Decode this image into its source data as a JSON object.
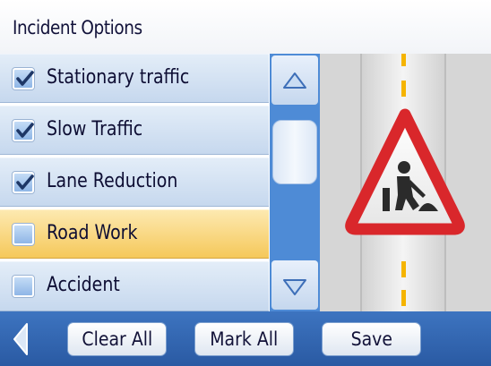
{
  "header": {
    "title": "Incident Options"
  },
  "options": [
    {
      "label": "Stationary traffic",
      "checked": true,
      "selected": false
    },
    {
      "label": "Slow Traffic",
      "checked": true,
      "selected": false
    },
    {
      "label": "Lane Reduction",
      "checked": true,
      "selected": false
    },
    {
      "label": "Road Work",
      "checked": false,
      "selected": true
    },
    {
      "label": "Accident",
      "checked": false,
      "selected": false
    }
  ],
  "preview": {
    "icon": "road-work-warning-sign"
  },
  "footer": {
    "back_icon": "back-arrow-icon",
    "clear_all": "Clear All",
    "mark_all": "Mark All",
    "save": "Save"
  },
  "colors": {
    "accent": "#2f66b3",
    "selected_row": "#f7cf66",
    "row": "#d3e2f3"
  }
}
